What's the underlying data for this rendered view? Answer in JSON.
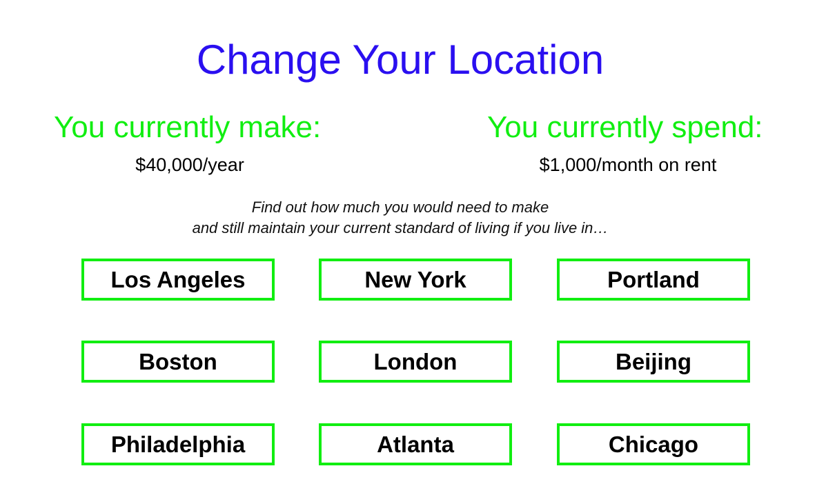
{
  "header": {
    "title": "Change Your Location"
  },
  "income": {
    "heading": "You currently make:",
    "value": "$40,000/year"
  },
  "spending": {
    "heading": "You currently spend:",
    "value": "$1,000/month on rent"
  },
  "prompt": {
    "line1": "Find out how much you would need to make",
    "line2": "and still maintain your current standard of living if you live in…"
  },
  "cities": [
    "Los Angeles",
    "New York",
    "Portland",
    "Boston",
    "London",
    "Beijing",
    "Philadelphia",
    "Atlanta",
    "Chicago"
  ],
  "colors": {
    "title": "#2a0ff0",
    "accent_green": "#11ee11",
    "text": "#000000",
    "background": "#ffffff"
  }
}
